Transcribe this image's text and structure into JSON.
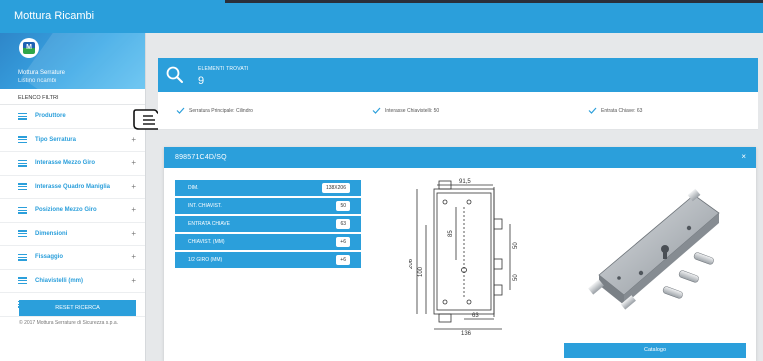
{
  "app": {
    "title": "Mottura Ricambi"
  },
  "sidebar": {
    "brand_title": "Mottura Serrature",
    "brand_subtitle": "Listino ricambi",
    "filters_title": "ELENCO FILTRI",
    "items": [
      {
        "label": "Produttore",
        "expandable": false
      },
      {
        "label": "Tipo Serratura",
        "expandable": true
      },
      {
        "label": "Interasse Mezzo Giro",
        "expandable": true
      },
      {
        "label": "Interasse Quadro Maniglia",
        "expandable": true
      },
      {
        "label": "Posizione Mezzo Giro",
        "expandable": true
      },
      {
        "label": "Dimensioni",
        "expandable": true
      },
      {
        "label": "Fissaggio",
        "expandable": true
      },
      {
        "label": "Chiavistelli (mm)",
        "expandable": true
      },
      {
        "label": "Mezzo Giro (mm)",
        "expandable": true
      }
    ],
    "plus_symbol": "+",
    "reset_label": "RESET RICERCA",
    "copyright": "© 2017 Mottura Serrature di Sicurezza s.p.a."
  },
  "results": {
    "label": "ELEMENTI TROVATI",
    "count": "9",
    "icon": "search-icon"
  },
  "active_filters": [
    {
      "label": "Serratura Principale: Cilindro"
    },
    {
      "label": "Interasse Chiavistelli: 50"
    },
    {
      "label": "Entrata Chiave: 63"
    }
  ],
  "modal": {
    "title": "898571C4D/SQ",
    "close_symbol": "×",
    "specs": [
      {
        "key": "DIM.",
        "value": "138X206"
      },
      {
        "key": "INT. CHIAVIST.",
        "value": "50"
      },
      {
        "key": "ENTRATA CHIAVE",
        "value": "63"
      },
      {
        "key": "CHIAVIST. (MM)",
        "value": "+6"
      },
      {
        "key": "1/2 GIRO (MM)",
        "value": "+6"
      }
    ],
    "drawing_dims": {
      "top_width": "91,5",
      "inner_height": "85",
      "spacing_top": "50",
      "spacing_bottom": "50",
      "total_height": "206",
      "backset": "100",
      "entry": "63",
      "total_width": "136"
    },
    "catalog_label": "Catalogo"
  },
  "colors": {
    "accent": "#2b9fdb",
    "background": "#e6e8ea"
  }
}
